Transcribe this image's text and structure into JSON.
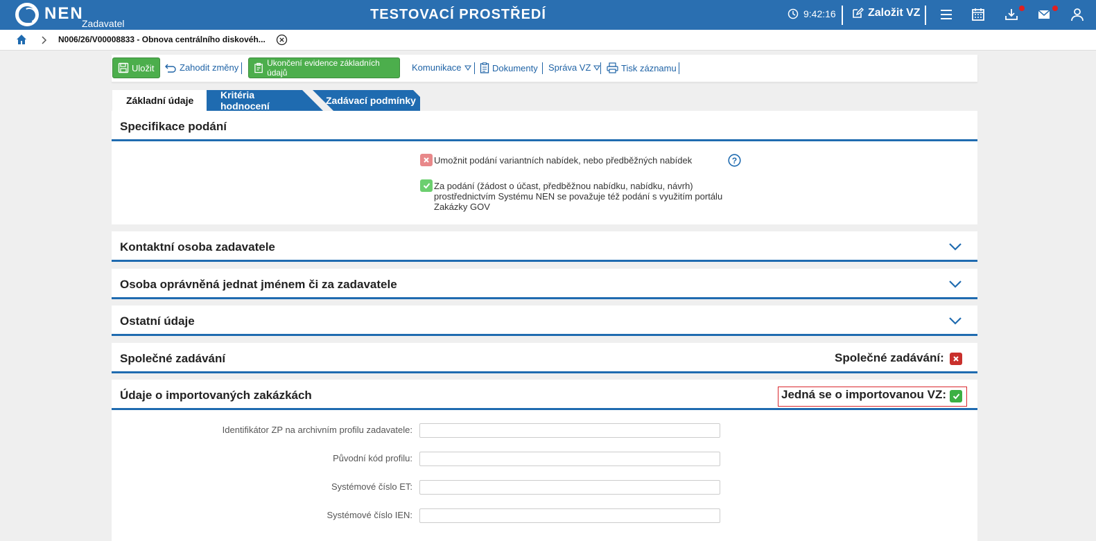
{
  "header": {
    "logo_text": "NEN",
    "logo_sub": "Zadavatel",
    "env_title": "TESTOVACÍ PROSTŘEDÍ",
    "clock": "9:42:16",
    "create_vz": "Založit VZ",
    "accent": "#2a6fb1"
  },
  "breadcrumb": {
    "text": "N006/26/V00008833 - Obnova centrálního diskovéh..."
  },
  "toolbar": {
    "save": "Uložit",
    "discard": "Zahodit změny",
    "finish": "Ukončení evidence základních údajů",
    "communication": "Komunikace",
    "documents": "Dokumenty",
    "manage": "Správa VZ",
    "print": "Tisk záznamu"
  },
  "tabs": [
    {
      "label": "Základní údaje",
      "active": true
    },
    {
      "label": "Kritéria hodnocení",
      "active": false
    },
    {
      "label": "Zadávací podmínky",
      "active": false
    }
  ],
  "spec": {
    "title": "Specifikace podání",
    "opt1": "Umožnit podání variantních nabídek, nebo předběžných nabídek",
    "opt1_checked": false,
    "opt2_line1": "Za podání (žádost o účast, předběžnou nabídku, nabídku, návrh)",
    "opt2_line2": "prostřednictvím Systému NEN se považuje též podání s využitím portálu",
    "opt2_line3": "Zakázky GOV",
    "opt2_checked": true
  },
  "sections": {
    "contact": "Kontaktní osoba zadavatele",
    "authorized": "Osoba oprávněná jednat jménem či za zadavatele",
    "other": "Ostatní údaje",
    "joint": "Společné zadávání",
    "joint_label": "Společné zadávání:",
    "joint_checked": false,
    "imported": "Údaje o importovaných zakázkách",
    "imported_label": "Jedná se o importovanou VZ:",
    "imported_checked": true
  },
  "form": {
    "field1_label": "Identifikátor ZP na archivním profilu zadavatele:",
    "field1_value": "",
    "field2_label": "Původní kód profilu:",
    "field2_value": "",
    "field3_label": "Systémové číslo ET:",
    "field3_value": "",
    "field4_label": "Systémové číslo IEN:",
    "field4_value": ""
  }
}
